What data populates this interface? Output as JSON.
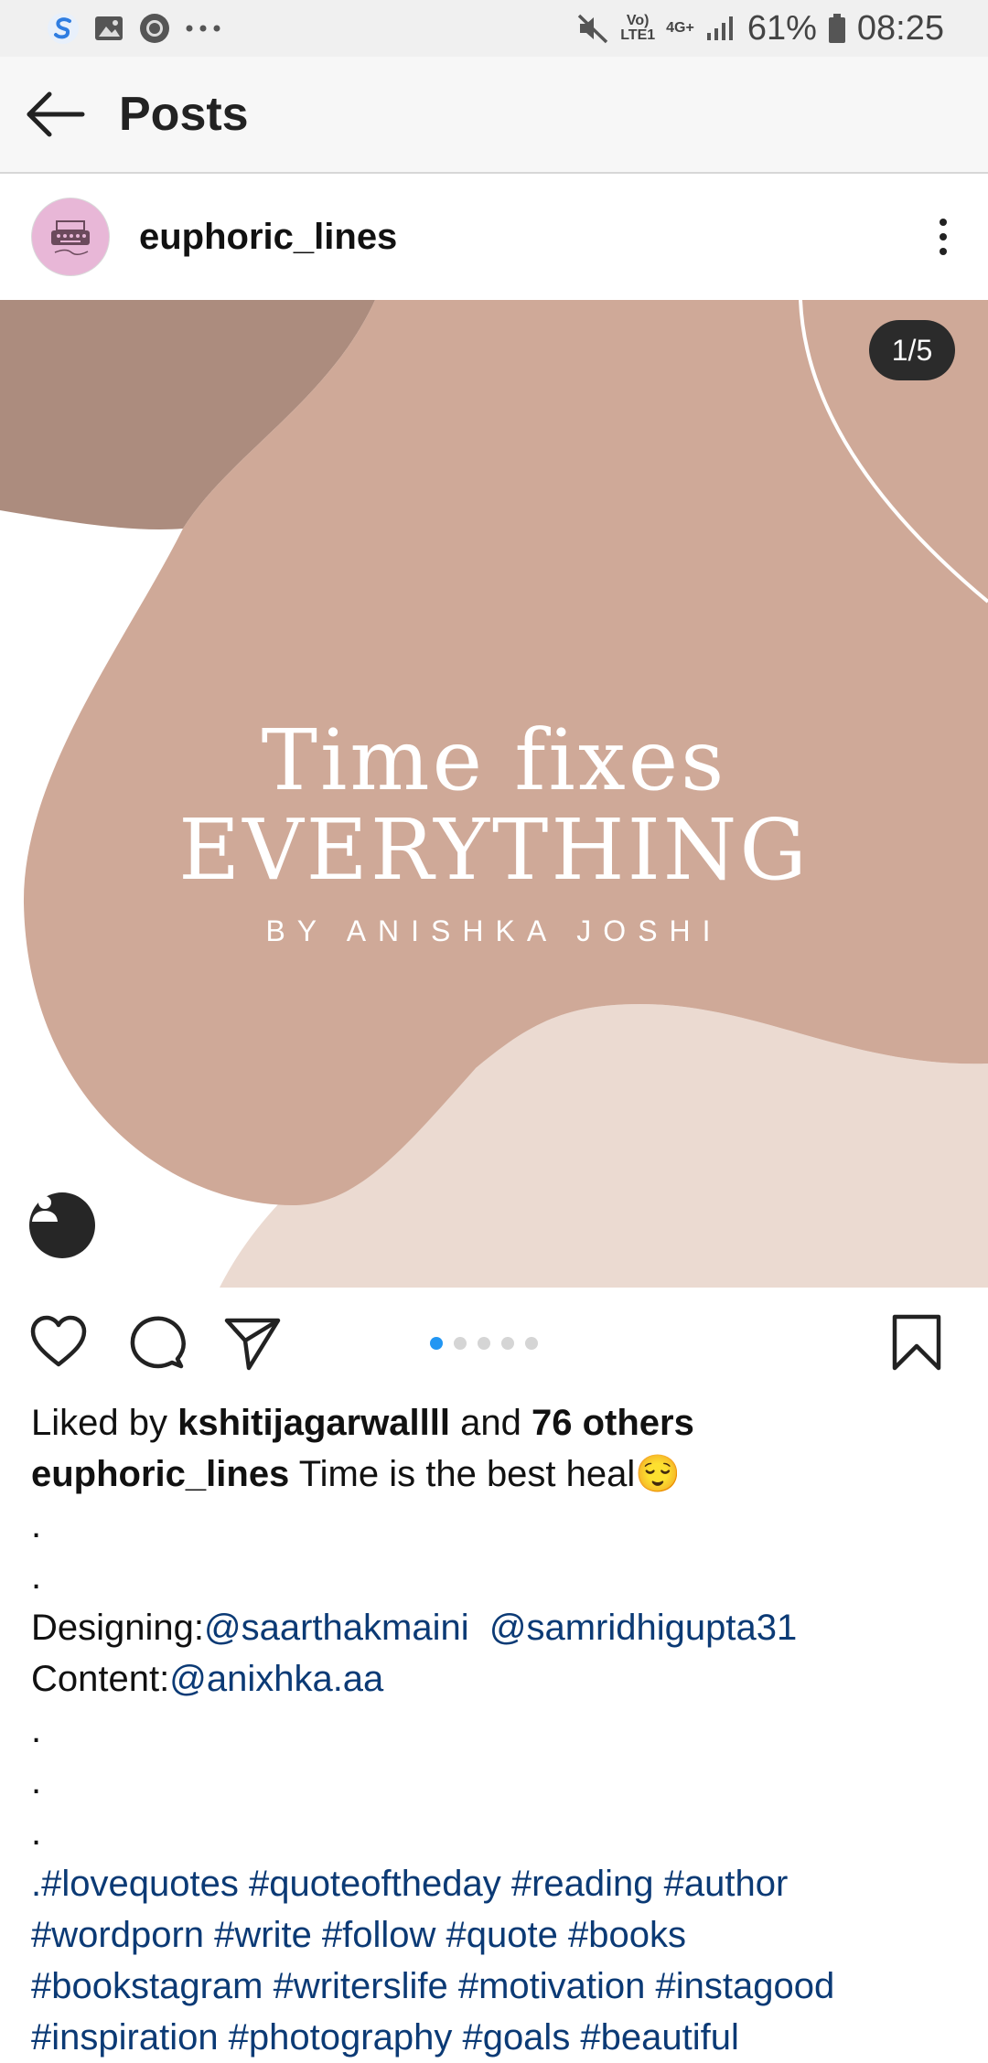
{
  "status_bar": {
    "network_small": "Vo)\nLTE1",
    "network_type": "4G+",
    "battery": "61%",
    "time": "08:25"
  },
  "appbar": {
    "title": "Posts"
  },
  "post": {
    "username": "euphoric_lines",
    "counter": "1/5",
    "image_text": {
      "line1": "Time fixes",
      "line2": "EVERYTHING",
      "byline": "BY ANISHKA JOSHI"
    },
    "carousel": {
      "count": 5,
      "active_index": 0
    },
    "likes": {
      "prefix": "Liked by ",
      "user": "kshitijagarwallll",
      "middle": " and ",
      "others": "76 others"
    },
    "caption": {
      "author": "euphoric_lines",
      "text": " Time is the best heal😌",
      "dot1": ".",
      "dot2": ".",
      "designing_label": "Designing:",
      "designer1": "@saarthakmaini",
      "designer2": "@samridhigupta31",
      "content_label": "Content:",
      "content_author": "@anixhka.aa",
      "dot3": ".",
      "dot4": ".",
      "dot5": ".",
      "hashtags_line1": ".#lovequotes #quoteoftheday #reading #author",
      "hashtags_line2": "#wordporn #write #follow #quote #books",
      "hashtags_line3": "#bookstagram #writerslife #motivation #instagood",
      "hashtags_line4": "#inspiration #photography #goals #beautiful"
    }
  },
  "colors": {
    "accent_blue": "#2196f3",
    "link": "#0b3a75",
    "blob_main": "#cfa998",
    "blob_dark": "#ac8c7e",
    "blob_light": "#ebdad1"
  }
}
